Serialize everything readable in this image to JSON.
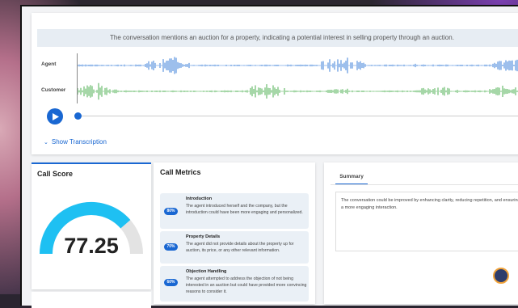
{
  "summary_text": "The conversation mentions an auction for a property, indicating a potential interest in selling property through an auction.",
  "tracks": {
    "agent_label": "Agent",
    "customer_label": "Customer",
    "agent_color": "#3b7fd9",
    "customer_color": "#4caf50"
  },
  "player": {
    "play_icon": "play-icon",
    "position": 0
  },
  "show_transcription": "Show Transcription",
  "call_score": {
    "title": "Call Score",
    "value": "77.25",
    "gauge_fraction": 0.7725,
    "gauge_color": "#1ec0f2",
    "gauge_track_color": "#e3e3e3"
  },
  "call_metrics": {
    "title": "Call Metrics",
    "items": [
      {
        "percent": "80%",
        "title": "Introduction",
        "text": "The agent introduced herself and the company, but the introduction could have been more engaging and personalized."
      },
      {
        "percent": "70%",
        "title": "Property Details",
        "text": "The agent did not provide details about the property up for auction, its price, or any other relevant information."
      },
      {
        "percent": "60%",
        "title": "Objection Handling",
        "text": "The agent attempted to address the objection of not being interested in an auction but could have provided more convincing reasons to consider it."
      }
    ]
  },
  "summary": {
    "tab_label": "Summary",
    "text": "The conversation could be improved by enhancing clarity, reducing repetition, and ensuring a more engaging interaction."
  },
  "accent_color": "#1967d2"
}
